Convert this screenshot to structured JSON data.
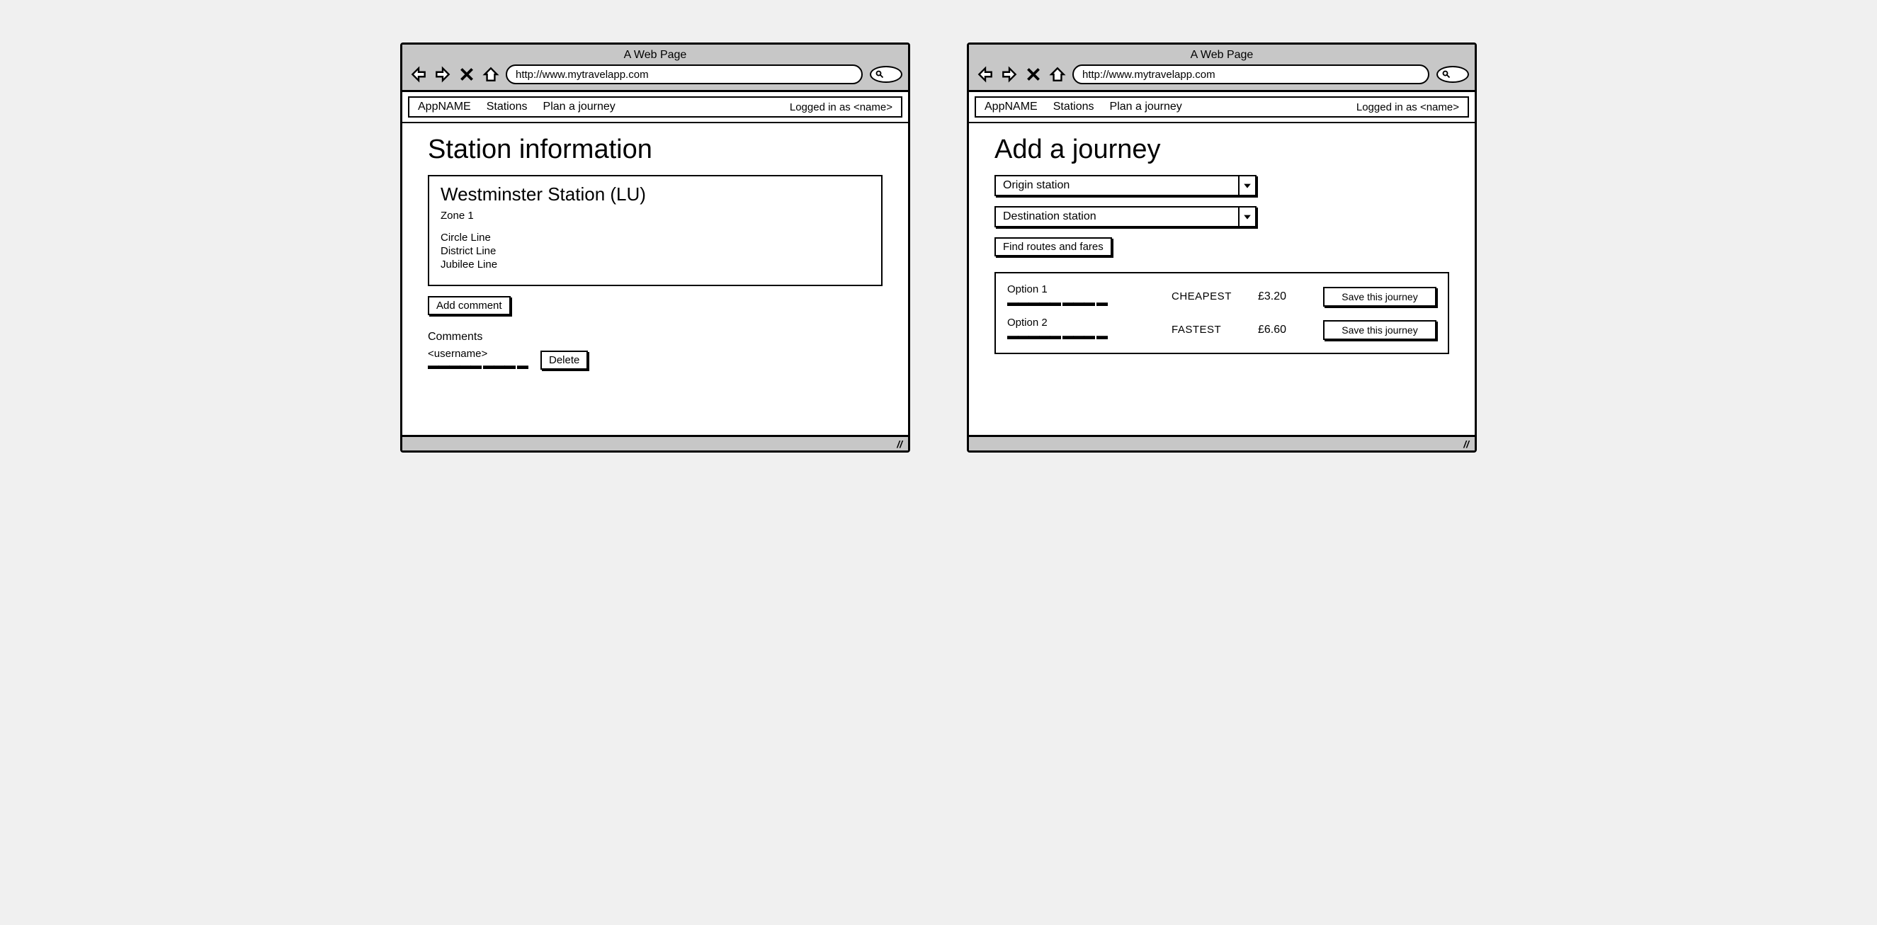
{
  "browser": {
    "title": "A Web Page",
    "url": "http://www.mytravelapp.com"
  },
  "nav": {
    "app_name": "AppNAME",
    "items": [
      "Stations",
      "Plan a journey"
    ],
    "logged_in_text": "Logged in as <name>"
  },
  "left": {
    "page_title": "Station information",
    "station": {
      "name": "Westminster Station (LU)",
      "zone": "Zone 1",
      "lines": [
        "Circle Line",
        "District Line",
        "Jubilee Line"
      ]
    },
    "add_comment_label": "Add comment",
    "comments_heading": "Comments",
    "comment": {
      "username": "<username>",
      "body_scribble": "▬▬▬▬▬ ▬▬▬ ▬",
      "delete_label": "Delete"
    }
  },
  "right": {
    "page_title": "Add a journey",
    "origin_placeholder": "Origin station",
    "destination_placeholder": "Destination station",
    "find_button": "Find routes and fares",
    "options": [
      {
        "label": "Option 1",
        "scribble": "▬▬▬▬▬ ▬▬▬ ▬",
        "tag": "CHEAPEST",
        "fare": "£3.20",
        "save_label": "Save this journey"
      },
      {
        "label": "Option 2",
        "scribble": "▬▬▬▬▬ ▬▬▬ ▬",
        "tag": "FASTEST",
        "fare": "£6.60",
        "save_label": "Save this journey"
      }
    ]
  }
}
